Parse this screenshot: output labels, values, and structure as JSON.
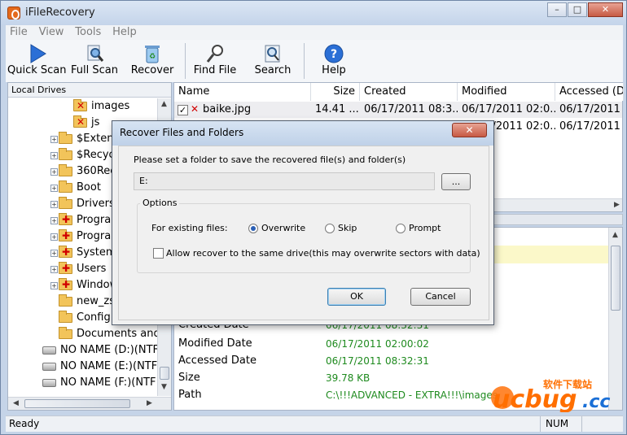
{
  "app": {
    "title": "iFileRecovery"
  },
  "menu": [
    "File",
    "View",
    "Tools",
    "Help"
  ],
  "toolbar": {
    "quick_scan": "Quick Scan",
    "full_scan": "Full Scan",
    "recover": "Recover",
    "find_file": "Find File",
    "search": "Search",
    "help": "Help"
  },
  "left_pane": {
    "header": "Local Drives",
    "tree": [
      {
        "label": "images",
        "kind": "deleted"
      },
      {
        "label": "js",
        "kind": "deleted"
      },
      {
        "label": "$Extend",
        "kind": "folder"
      },
      {
        "label": "$Recycle",
        "kind": "folder"
      },
      {
        "label": "360Rec",
        "kind": "folder"
      },
      {
        "label": "Boot",
        "kind": "folder"
      },
      {
        "label": "Drivers",
        "kind": "folder"
      },
      {
        "label": "Program",
        "kind": "folder-red"
      },
      {
        "label": "Program",
        "kind": "folder-red"
      },
      {
        "label": "System",
        "kind": "folder-red"
      },
      {
        "label": "Users",
        "kind": "folder-red"
      },
      {
        "label": "Window",
        "kind": "folder-red"
      },
      {
        "label": "new_zsz",
        "kind": "folder"
      },
      {
        "label": "Config.M",
        "kind": "folder"
      },
      {
        "label": "Documents and",
        "kind": "folder"
      },
      {
        "label": "NO NAME (D:)(NTF",
        "kind": "drive"
      },
      {
        "label": "NO NAME (E:)(NTF",
        "kind": "drive"
      },
      {
        "label": "NO NAME (F:)(NTF",
        "kind": "drive"
      }
    ]
  },
  "file_list": {
    "columns": [
      "Name",
      "Size",
      "Created",
      "Modified",
      "Accessed (D"
    ],
    "rows": [
      {
        "name": "baike.jpg",
        "size": "14.41 ...",
        "created": "06/17/2011 08:3...",
        "modified": "06/17/2011 02:0...",
        "accessed": "06/17/2011 02:0..."
      },
      {
        "name": "",
        "size": "",
        "created": "",
        "modified": "06/17/2011 02:0...",
        "accessed": "06/17/2011 02:0..."
      }
    ]
  },
  "details": [
    {
      "label": "Created Date",
      "value": "06/17/2011 08:32:31"
    },
    {
      "label": "Modified Date",
      "value": "06/17/2011 02:00:02"
    },
    {
      "label": "Accessed Date",
      "value": "06/17/2011 08:32:31"
    },
    {
      "label": "Size",
      "value": "39.78 KB"
    },
    {
      "label": "Path",
      "value": "C:\\!!!ADVANCED - EXTRA!!!\\images"
    }
  ],
  "status": {
    "text": "Ready",
    "num": "NUM"
  },
  "dialog": {
    "title": "Recover Files and Folders",
    "prompt": "Please set a folder to save the recovered file(s) and folder(s)",
    "path_value": "E:",
    "browse_label": "...",
    "options_label": "Options",
    "existing_label": "For existing files:",
    "radio_overwrite": "Overwrite",
    "radio_skip": "Skip",
    "radio_prompt": "Prompt",
    "selected_option": "Overwrite",
    "allow_same_drive": "Allow recover to the same drive(this may overwrite sectors with data)",
    "allow_same_drive_checked": false,
    "ok_label": "OK",
    "cancel_label": "Cancel"
  },
  "watermark": {
    "text": "ucbug.cc",
    "tagline": "软件下载站"
  }
}
